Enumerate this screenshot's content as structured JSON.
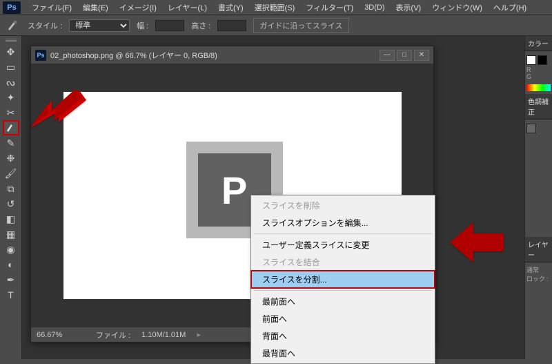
{
  "app_logo": "Ps",
  "menus": [
    "ファイル(F)",
    "編集(E)",
    "イメージ(I)",
    "レイヤー(L)",
    "書式(Y)",
    "選択範囲(S)",
    "フィルター(T)",
    "3D(D)",
    "表示(V)",
    "ウィンドウ(W)",
    "ヘルプ(H)"
  ],
  "options": {
    "style_label": "スタイル :",
    "style_value": "標準",
    "width_label": "幅 :",
    "height_label": "高さ :",
    "guide_btn": "ガイドに沿ってスライス"
  },
  "document": {
    "title": "02_photoshop.png @ 66.7% (レイヤー 0, RGB/8)",
    "ps_mark": "P"
  },
  "status": {
    "zoom": "66.67%",
    "file_label": "ファイル :",
    "file_size": "1.10M/1.01M"
  },
  "panels": {
    "color": "カラー",
    "r": "R",
    "g": "G",
    "adjustments": "色調補正",
    "layers": "レイヤー",
    "normal": "通常",
    "lock": "ロック :"
  },
  "context": {
    "delete": "スライスを削除",
    "edit_opts": "スライスオプションを編集...",
    "to_user": "ユーザー定義スライスに変更",
    "combine": "スライスを結合",
    "split": "スライスを分割...",
    "bring_front": "最前面へ",
    "bring_forward": "前面へ",
    "send_backward": "背面へ",
    "send_back": "最背面へ"
  },
  "tool_names": [
    "move",
    "marquee",
    "lasso",
    "crop",
    "wand",
    "eyedropper-highlighted",
    "eyedropper",
    "spot-heal",
    "brush",
    "clone",
    "eraser",
    "gradient",
    "pen",
    "blur",
    "dodge",
    "path",
    "text"
  ]
}
